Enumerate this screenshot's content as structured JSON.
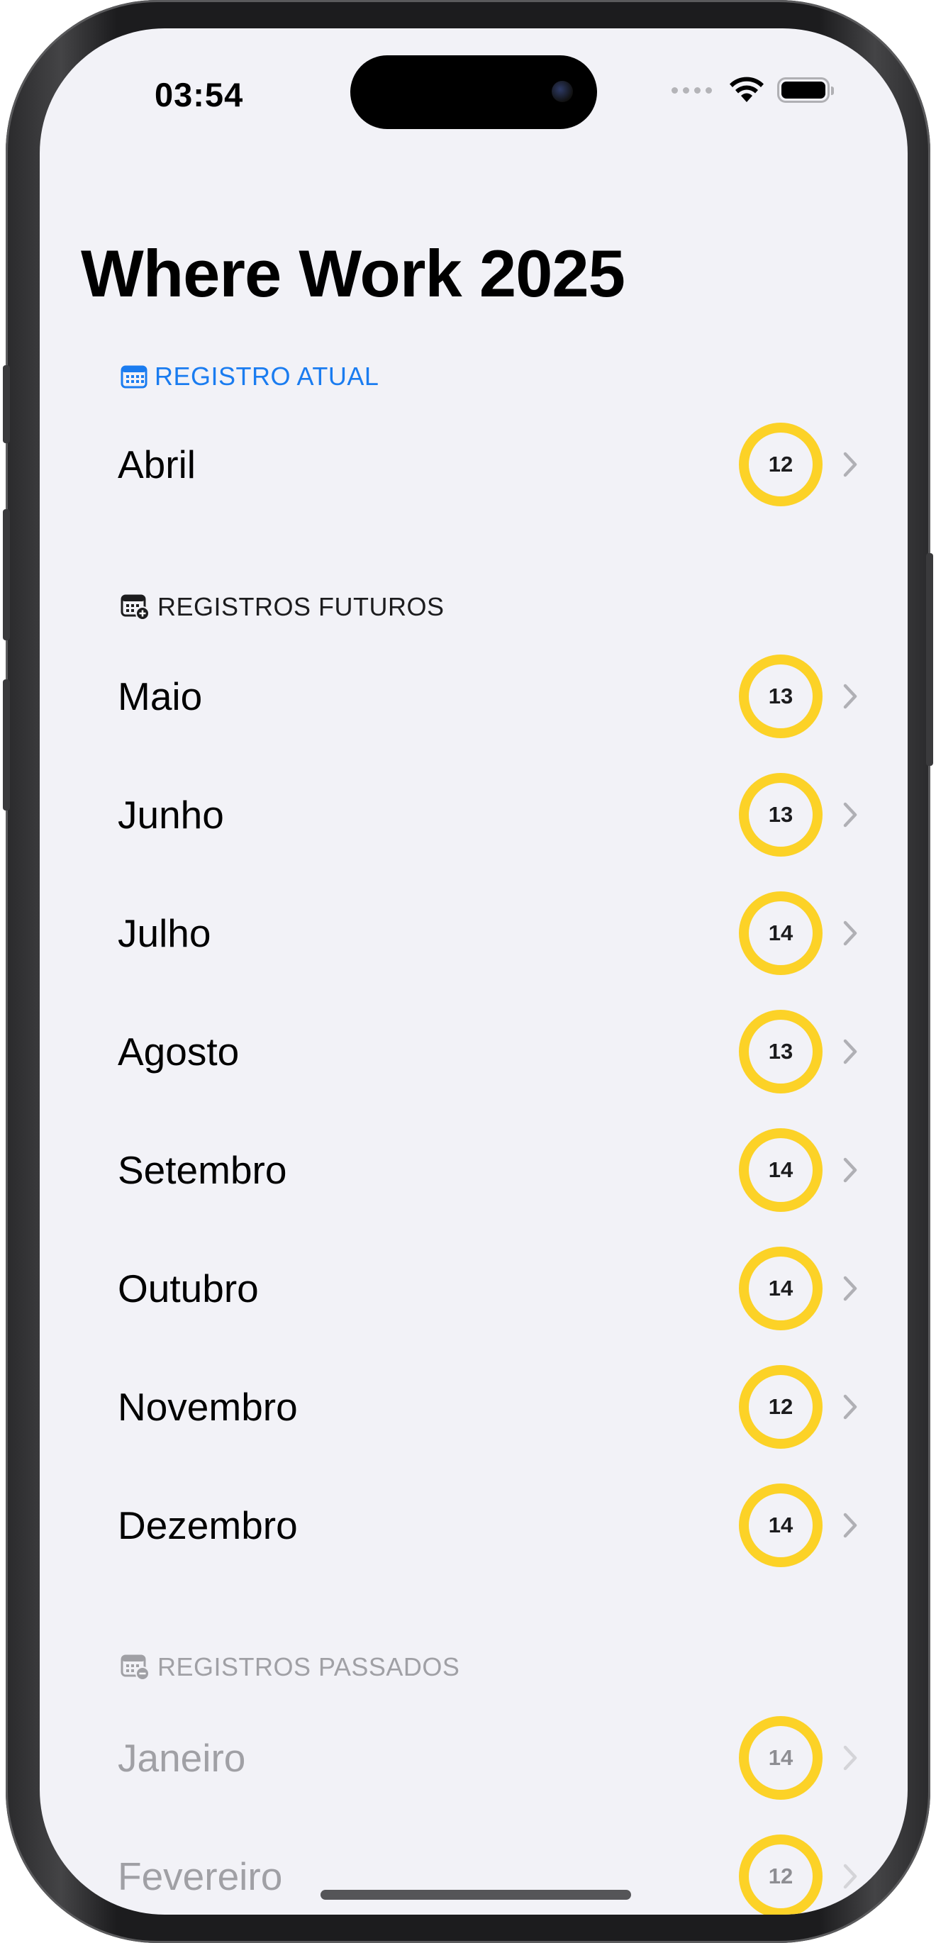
{
  "status_bar": {
    "time": "03:54"
  },
  "header": {
    "title": "Where Work 2025"
  },
  "sections": {
    "current": {
      "label": "REGISTRO ATUAL",
      "icon": "calendar-icon",
      "color": "#1a7cf0",
      "items": [
        {
          "month": "Abril",
          "count": "12"
        }
      ]
    },
    "future": {
      "label": "REGISTROS FUTUROS",
      "icon": "calendar-badge-plus-icon",
      "color": "#1c1c1e",
      "items": [
        {
          "month": "Maio",
          "count": "13"
        },
        {
          "month": "Junho",
          "count": "13"
        },
        {
          "month": "Julho",
          "count": "14"
        },
        {
          "month": "Agosto",
          "count": "13"
        },
        {
          "month": "Setembro",
          "count": "14"
        },
        {
          "month": "Outubro",
          "count": "14"
        },
        {
          "month": "Novembro",
          "count": "12"
        },
        {
          "month": "Dezembro",
          "count": "14"
        }
      ]
    },
    "past": {
      "label": "REGISTROS PASSADOS",
      "icon": "calendar-badge-minus-icon",
      "color": "#a0a0a5",
      "items": [
        {
          "month": "Janeiro",
          "count": "14"
        },
        {
          "month": "Fevereiro",
          "count": "12"
        }
      ]
    }
  },
  "colors": {
    "ring": "#fcd227",
    "background": "#f2f2f7",
    "accent": "#1a7cf0"
  }
}
